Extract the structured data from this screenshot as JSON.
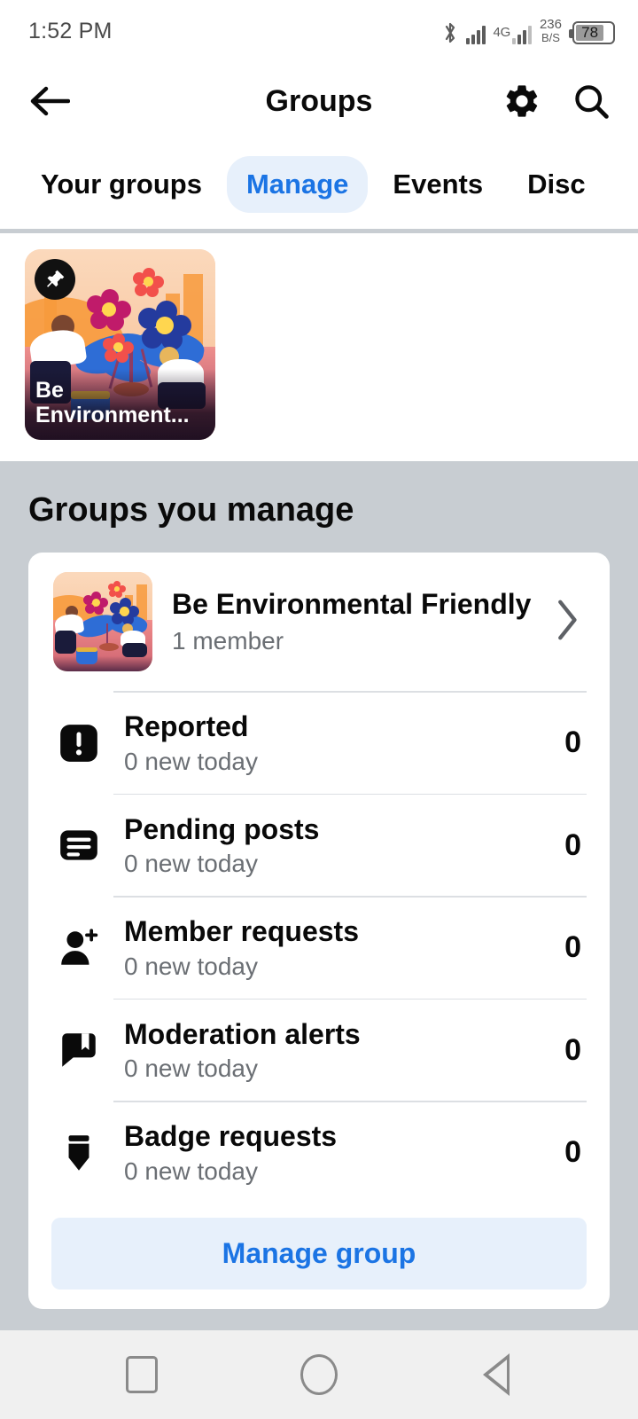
{
  "status_bar": {
    "time": "1:52 PM",
    "bluetooth_icon": "bluetooth-icon",
    "signal_icon": "signal-bars-icon",
    "network_type": "4G",
    "data_rate_value": "236",
    "data_rate_unit": "B/S",
    "battery_level": "78"
  },
  "header": {
    "back_icon": "back-arrow-icon",
    "title": "Groups",
    "settings_icon": "gear-icon",
    "search_icon": "search-icon"
  },
  "tabs": [
    {
      "label": "Your groups",
      "active": false
    },
    {
      "label": "Manage",
      "active": true
    },
    {
      "label": "Events",
      "active": false
    },
    {
      "label": "Disc",
      "active": false
    }
  ],
  "pinned": {
    "pin_icon": "pushpin-icon",
    "label": "Be Environment..."
  },
  "section": {
    "title": "Groups you manage"
  },
  "group": {
    "name": "Be Environmental Friendly",
    "members": "1 member",
    "chevron_icon": "chevron-right-icon"
  },
  "stats": [
    {
      "icon": "report-exclamation-icon",
      "label": "Reported",
      "sub": "0 new today",
      "count": "0"
    },
    {
      "icon": "pending-post-icon",
      "label": "Pending posts",
      "sub": "0 new today",
      "count": "0"
    },
    {
      "icon": "person-add-icon",
      "label": "Member requests",
      "sub": "0 new today",
      "count": "0"
    },
    {
      "icon": "moderation-alert-icon",
      "label": "Moderation alerts",
      "sub": "0 new today",
      "count": "0"
    },
    {
      "icon": "badge-shield-icon",
      "label": "Badge requests",
      "sub": "0 new today",
      "count": "0"
    }
  ],
  "manage_button": {
    "label": "Manage group"
  },
  "nav_bar": {
    "recents_icon": "square-recents-icon",
    "home_icon": "circle-home-icon",
    "back_icon": "triangle-back-icon"
  },
  "colors": {
    "accent_blue": "#1B74E4",
    "accent_blue_bg": "#E7F0FB",
    "page_bg": "#C8CDD2",
    "card_bg": "#FFFFFF",
    "muted_text": "#6B6F74"
  }
}
